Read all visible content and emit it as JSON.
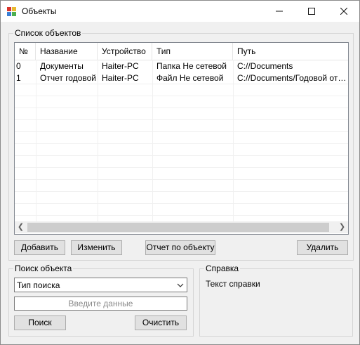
{
  "window": {
    "title": "Объекты"
  },
  "objects_group": {
    "label": "Список объектов",
    "columns": [
      "№",
      "Название",
      "Устройство",
      "Тип",
      "Путь"
    ],
    "rows": [
      [
        "0",
        "Документы",
        "Haiter-PC",
        "Папка Не сетевой",
        "C://Documents"
      ],
      [
        "1",
        "Отчет годовой",
        "Haiter-PC",
        "Файл Не сетевой",
        "C://Documents/Годовой отчет..."
      ]
    ]
  },
  "buttons": {
    "add": "Добавить",
    "edit": "Изменить",
    "report": "Отчет по объекту",
    "delete": "Удалить"
  },
  "search_group": {
    "label": "Поиск объекта",
    "search_type": "Тип поиска",
    "input_placeholder": "Введите данные",
    "search_button": "Поиск",
    "clear_button": "Очистить"
  },
  "help_group": {
    "label": "Справка",
    "text": "Текст справки"
  },
  "colors": {
    "titlebar": "#ffffff",
    "window_bg": "#f0f0f0",
    "button_bg": "#e1e1e1"
  },
  "icons": [
    "app-icon",
    "minimize-icon",
    "maximize-icon",
    "close-icon",
    "scroll-left-icon",
    "scroll-right-icon",
    "chevron-down-icon"
  ]
}
